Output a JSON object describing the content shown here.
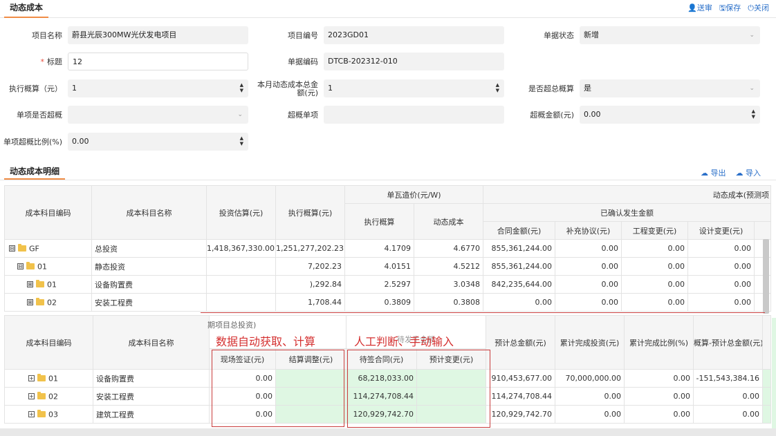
{
  "header": {
    "title": "动态成本",
    "actions": {
      "submit": "送审",
      "save": "保存",
      "close": "关闭"
    }
  },
  "form": {
    "project_name": {
      "label": "项目名称",
      "value": "蔚县光辰300MW光伏发电项目"
    },
    "project_code": {
      "label": "项目编号",
      "value": "2023GD01"
    },
    "doc_status": {
      "label": "单据状态",
      "value": "新增"
    },
    "title": {
      "label": "标题",
      "value": "12"
    },
    "doc_code": {
      "label": "单据编码",
      "value": "DTCB-202312-010"
    },
    "exec_budget": {
      "label": "执行概算（元）",
      "value": "1"
    },
    "month_total_label_1": "本月动态成本总金",
    "month_total_label_2": "额(元)",
    "month_total_value": "1",
    "over_budget": {
      "label": "是否超总概算",
      "value": "是"
    },
    "item_over": {
      "label": "单项是否超概",
      "value": ""
    },
    "over_item": {
      "label": "超概单项",
      "value": ""
    },
    "over_amount": {
      "label": "超概金额(元)",
      "value": "0.00"
    },
    "over_ratio": {
      "label": "单项超概比例(%)",
      "value": "0.00"
    }
  },
  "detail": {
    "title": "动态成本明细",
    "export": "导出",
    "import": "导入"
  },
  "table_top": {
    "headers": {
      "code": "成本科目编码",
      "name": "成本科目名称",
      "invest_est": "投资估算(元)",
      "exec_budget": "执行概算(元)",
      "unit_cost": "单瓦造价(元/W)",
      "unit_exec": "执行概算",
      "unit_dyn": "动态成本",
      "dyn_cost": "动态成本(预测项",
      "confirmed": "已确认发生金额",
      "contract": "合同金额(元)",
      "supplement": "补充协议(元)",
      "eng_change": "工程变更(元)",
      "design_change": "设计变更(元)"
    },
    "rows": [
      {
        "sign": "⊟",
        "code": "GF",
        "name": "总投资",
        "invest": "1,418,367,330.00",
        "exec": "1,251,277,202.23",
        "u_exec": "4.1709",
        "u_dyn": "4.6770",
        "contract": "855,361,244.00",
        "supp": "0.00",
        "eng": "0.00",
        "design": "0.00"
      },
      {
        "sign": "⊟",
        "code": "01",
        "name": "静态投资",
        "invest": "",
        "exec": "7,202.23",
        "u_exec": "4.0151",
        "u_dyn": "4.5212",
        "contract": "855,361,244.00",
        "supp": "0.00",
        "eng": "0.00",
        "design": "0.00"
      },
      {
        "sign": "⊞",
        "code": "01",
        "name": "设备购置费",
        "invest": "",
        "exec": "),292.84",
        "u_exec": "2.5297",
        "u_dyn": "3.0348",
        "contract": "842,235,644.00",
        "supp": "0.00",
        "eng": "0.00",
        "design": "0.00"
      },
      {
        "sign": "⊞",
        "code": "02",
        "name": "安装工程费",
        "invest": "",
        "exec": "1,708.44",
        "u_exec": "0.3809",
        "u_dyn": "0.3808",
        "contract": "0.00",
        "supp": "0.00",
        "eng": "0.00",
        "design": "0.00"
      }
    ]
  },
  "table_bottom": {
    "floating_header": "期项目总投资)",
    "headers": {
      "code": "成本科目编码",
      "name": "成本科目名称",
      "site_visa": "现场签证(元)",
      "settle_adj": "结算调整(元)",
      "pending_contract": "待签合同(元)",
      "est_change": "预计变更(元)",
      "pending_amount": "待发生金额",
      "est_total": "预计总金额(元)",
      "accum_invest": "累计完成投资(元)",
      "accum_ratio": "累计完成比例(%)",
      "budget_diff": "概算-预计总金额(元)"
    },
    "rows": [
      {
        "code": "01",
        "name": "设备购置费",
        "site": "0.00",
        "settle": "",
        "pending": "68,218,033.00",
        "change": "",
        "total": "910,453,677.00",
        "accum": "70,000,000.00",
        "ratio": "0.00",
        "diff": "-151,543,384.16"
      },
      {
        "code": "02",
        "name": "安装工程费",
        "site": "0.00",
        "settle": "",
        "pending": "114,274,708.44",
        "change": "",
        "total": "114,274,708.44",
        "accum": "0.00",
        "ratio": "0.00",
        "diff": "0.00"
      },
      {
        "code": "03",
        "name": "建筑工程费",
        "site": "0.00",
        "settle": "",
        "pending": "120,929,742.70",
        "change": "",
        "total": "120,929,742.70",
        "accum": "0.00",
        "ratio": "0.00",
        "diff": "0.00"
      }
    ]
  },
  "annotations": {
    "auto": "数据自动获取、计算",
    "manual": "人工判断、手动输入"
  },
  "colors": {
    "accent": "#f08c45",
    "link": "#2a6fc9",
    "annotation": "#d43030",
    "editable": "#dff7e3"
  }
}
